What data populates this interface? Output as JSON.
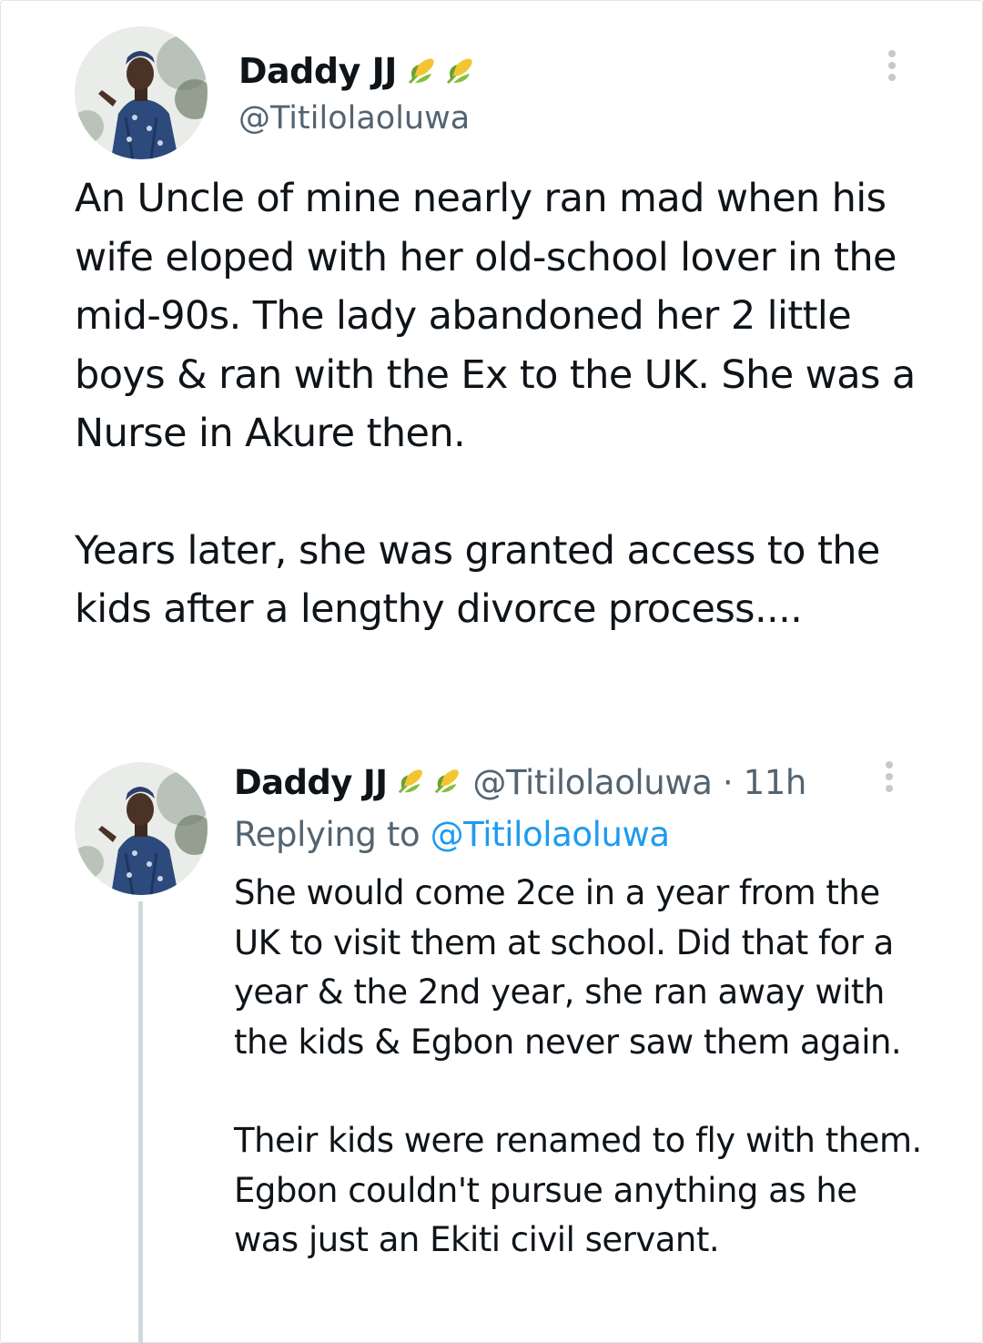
{
  "main_tweet": {
    "display_name": "Daddy JJ",
    "badge_icons": [
      "corn-icon",
      "corn-icon"
    ],
    "handle": "@Titilolaoluwa",
    "paragraphs": [
      "An Uncle of mine nearly ran mad when his wife eloped with her old-school lover in the mid-90s. The lady abandoned her 2 little boys & ran with the Ex to the UK. She was a Nurse in Akure then.",
      "Years later, she was granted access to the kids after a lengthy divorce process...."
    ]
  },
  "reply_tweet": {
    "display_name": "Daddy JJ",
    "badge_icons": [
      "corn-icon",
      "corn-icon"
    ],
    "handle": "@Titilolaoluwa",
    "separator": "·",
    "time": "11h",
    "replying_label": "Replying to",
    "replying_to": "@Titilolaoluwa",
    "paragraphs": [
      "She would come 2ce in a year from the UK to visit them at school. Did that for a year & the 2nd year, she ran away with the kids & Egbon never saw them again.",
      "Their kids were renamed to fly with them. Egbon couldn't pursue anything as he was just an Ekiti civil servant."
    ]
  },
  "colors": {
    "text": "#0f1419",
    "secondary": "#536471",
    "link": "#1d9bf0",
    "thread_line": "#cfd9de"
  }
}
